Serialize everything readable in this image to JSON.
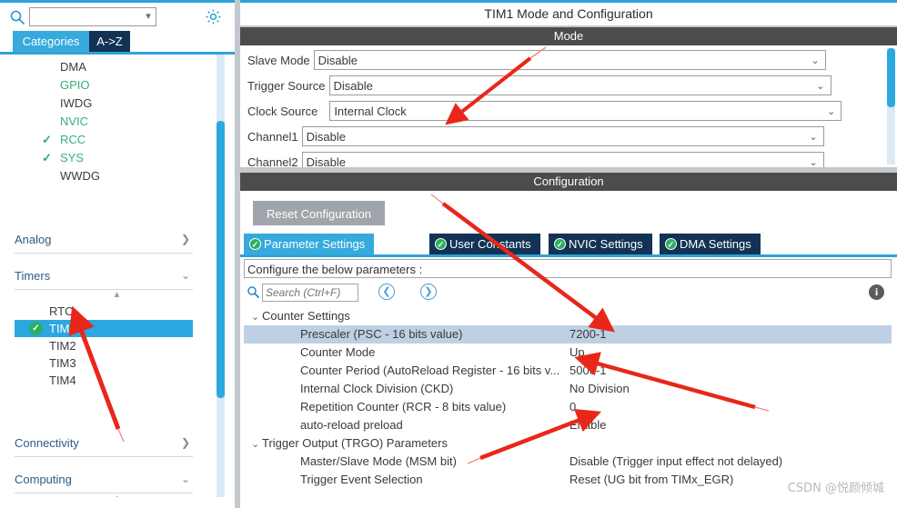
{
  "left_panel": {
    "search": {
      "value": "",
      "placeholder": ""
    },
    "search_icon": "search-icon",
    "gear_icon": "gear-icon",
    "tabs": [
      {
        "label": "Categories",
        "selected": true
      },
      {
        "label": "A->Z",
        "selected": false
      }
    ],
    "top_items": [
      {
        "label": "DMA",
        "checked": false,
        "green": false
      },
      {
        "label": "GPIO",
        "checked": false,
        "green": true
      },
      {
        "label": "IWDG",
        "checked": false,
        "green": false
      },
      {
        "label": "NVIC",
        "checked": false,
        "green": true
      },
      {
        "label": "RCC",
        "checked": true,
        "green": true
      },
      {
        "label": "SYS",
        "checked": true,
        "green": true
      },
      {
        "label": "WWDG",
        "checked": false,
        "green": false
      }
    ],
    "groups": [
      {
        "label": "Analog",
        "expanded": false,
        "chevron": "chevron-right-icon"
      },
      {
        "label": "Timers",
        "expanded": true,
        "chevron": "chevron-down-icon"
      }
    ],
    "timers": [
      {
        "label": "RTC",
        "checked": false,
        "selected": false
      },
      {
        "label": "TIM1",
        "checked": true,
        "selected": true
      },
      {
        "label": "TIM2",
        "checked": false,
        "selected": false
      },
      {
        "label": "TIM3",
        "checked": false,
        "selected": false
      },
      {
        "label": "TIM4",
        "checked": false,
        "selected": false
      }
    ],
    "bottom_groups": [
      {
        "label": "Connectivity",
        "expanded": false,
        "chevron": "chevron-right-icon"
      },
      {
        "label": "Computing",
        "expanded": true,
        "chevron": "chevron-down-icon"
      }
    ]
  },
  "right_panel": {
    "title": "TIM1 Mode and Configuration",
    "mode": {
      "header": "Mode",
      "rows": [
        {
          "label": "Slave Mode",
          "value": "Disable"
        },
        {
          "label": "Trigger Source",
          "value": "Disable"
        },
        {
          "label": "Clock Source",
          "value": "Internal Clock"
        },
        {
          "label": "Channel1",
          "value": "Disable"
        },
        {
          "label": "Channel2",
          "value": "Disable"
        }
      ]
    },
    "configuration": {
      "header": "Configuration",
      "reset_button": "Reset Configuration",
      "tabs": [
        {
          "label": "Parameter Settings",
          "selected": true
        },
        {
          "label": "User Constants",
          "selected": false
        },
        {
          "label": "NVIC Settings",
          "selected": false
        },
        {
          "label": "DMA Settings",
          "selected": false
        }
      ],
      "note": "Configure the below parameters :",
      "search": {
        "value": "",
        "placeholder": "Search (Ctrl+F)"
      },
      "nav_prev_icon": "chevron-left-circle-icon",
      "nav_next_icon": "chevron-right-circle-icon",
      "info_icon": "info-icon",
      "parameters": [
        {
          "kind": "group",
          "label": "Counter Settings",
          "expanded": true
        },
        {
          "kind": "param",
          "label": "Prescaler (PSC - 16 bits value)",
          "value": "7200-1",
          "selected": true
        },
        {
          "kind": "param",
          "label": "Counter Mode",
          "value": "Up",
          "selected": false
        },
        {
          "kind": "param",
          "label": "Counter Period (AutoReload Register - 16 bits v...",
          "value": "5000-1",
          "selected": false
        },
        {
          "kind": "param",
          "label": "Internal Clock Division (CKD)",
          "value": "No Division",
          "selected": false
        },
        {
          "kind": "param",
          "label": "Repetition Counter (RCR - 8 bits value)",
          "value": "0",
          "selected": false
        },
        {
          "kind": "param",
          "label": "auto-reload preload",
          "value": "Enable",
          "selected": false
        },
        {
          "kind": "group",
          "label": "Trigger Output (TRGO) Parameters",
          "expanded": true
        },
        {
          "kind": "param",
          "label": "Master/Slave Mode (MSM bit)",
          "value": "Disable (Trigger input effect not delayed)",
          "selected": false
        },
        {
          "kind": "param",
          "label": "Trigger Event Selection",
          "value": "Reset (UG bit from TIMx_EGR)",
          "selected": false
        }
      ]
    }
  },
  "watermark": "CSDN @悦颜倾城",
  "colors": {
    "accent_blue": "#2fa3d8",
    "tab_selected": "#36a9dd",
    "tab_dark": "#123354",
    "header_gray": "#4c4c4c",
    "check_green": "#2eae62",
    "row_selected": "#bed0e3",
    "annotation_red": "#e8271a"
  }
}
